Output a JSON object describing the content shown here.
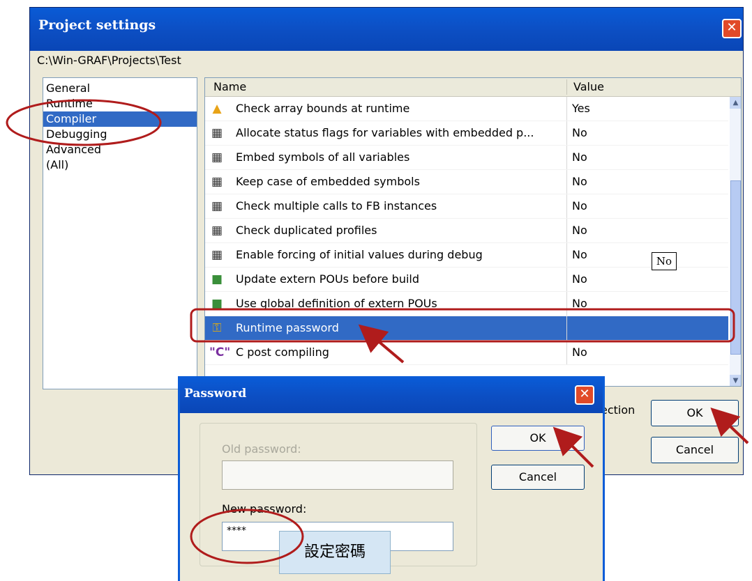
{
  "main": {
    "title": "Project settings",
    "path": "C:\\Win-GRAF\\Projects\\Test",
    "categories": [
      "General",
      "Runtime",
      "Compiler",
      "Debugging",
      "Advanced",
      "(All)"
    ],
    "grid_headers": {
      "name": "Name",
      "value": "Value"
    },
    "rows": [
      {
        "icon": "warning-icon",
        "name": "Check array bounds at runtime",
        "value": "Yes"
      },
      {
        "icon": "grid-icon",
        "name": "Allocate status flags for variables with embedded p...",
        "value": "No"
      },
      {
        "icon": "grid-icon",
        "name": "Embed symbols of all variables",
        "value": "No"
      },
      {
        "icon": "grid-icon",
        "name": "Keep case of embedded symbols",
        "value": "No"
      },
      {
        "icon": "grid-icon",
        "name": "Check multiple calls to FB instances",
        "value": "No"
      },
      {
        "icon": "grid-icon",
        "name": "Check duplicated profiles",
        "value": "No"
      },
      {
        "icon": "grid-icon",
        "name": "Enable forcing of initial values during debug",
        "value": "No"
      },
      {
        "icon": "book-icon",
        "name": "Update extern POUs before build",
        "value": "No"
      },
      {
        "icon": "book-icon",
        "name": "Use global definition of extern POUs",
        "value": "No"
      },
      {
        "icon": "key-icon",
        "name": "Runtime password",
        "value": ""
      },
      {
        "icon": "c-icon",
        "name": "C post compiling",
        "value": "No"
      }
    ],
    "inline_value_box": "No",
    "selection_text": "ection",
    "ok_label": "OK",
    "cancel_label": "Cancel"
  },
  "password_dialog": {
    "title": "Password",
    "old_label": "Old password:",
    "old_value": "",
    "new_label": "New password:",
    "new_value": "****",
    "ok_label": "OK",
    "cancel_label": "Cancel"
  },
  "annotation": {
    "callout": "設定密碼"
  },
  "colors": {
    "titlebar": "#0a5bd6",
    "selection": "#316ac5",
    "annotation_red": "#b01c1c",
    "callout_bg": "#d5e6f4"
  }
}
